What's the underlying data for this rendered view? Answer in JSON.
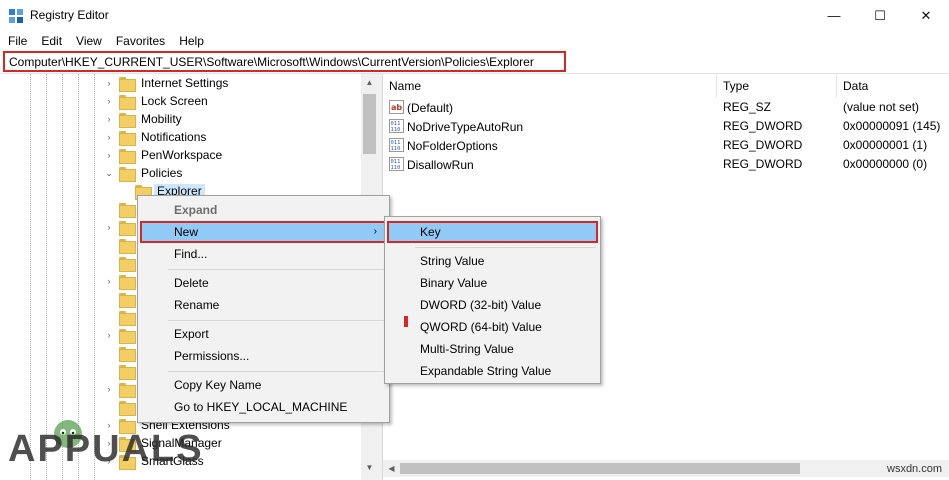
{
  "window": {
    "title": "Registry Editor",
    "minimize_glyph": "—",
    "maximize_glyph": "☐",
    "close_glyph": "✕"
  },
  "menubar": [
    "File",
    "Edit",
    "View",
    "Favorites",
    "Help"
  ],
  "address": "Computer\\HKEY_CURRENT_USER\\Software\\Microsoft\\Windows\\CurrentVersion\\Policies\\Explorer",
  "tree": {
    "items": [
      {
        "label": "Internet Settings",
        "chevron": "›"
      },
      {
        "label": "Lock Screen",
        "chevron": "›"
      },
      {
        "label": "Mobility",
        "chevron": "›"
      },
      {
        "label": "Notifications",
        "chevron": "›"
      },
      {
        "label": "PenWorkspace",
        "chevron": "›"
      },
      {
        "label": "Policies",
        "chevron": "⌄"
      },
      {
        "label": "Explorer",
        "chevron": ""
      },
      {
        "label": "Shell Extensions",
        "chevron": "›"
      },
      {
        "label": "SignalManager",
        "chevron": "›"
      },
      {
        "label": "SmartGlass",
        "chevron": "›"
      }
    ]
  },
  "listview": {
    "columns": [
      "Name",
      "Type",
      "Data"
    ],
    "rows": [
      {
        "icon": "string-value-icon",
        "name": "(Default)",
        "type": "REG_SZ",
        "data": "(value not set)"
      },
      {
        "icon": "binary-value-icon",
        "name": "NoDriveTypeAutoRun",
        "type": "REG_DWORD",
        "data": "0x00000091 (145)"
      },
      {
        "icon": "binary-value-icon",
        "name": "NoFolderOptions",
        "type": "REG_DWORD",
        "data": "0x00000001 (1)"
      },
      {
        "icon": "binary-value-icon",
        "name": "DisallowRun",
        "type": "REG_DWORD",
        "data": "0x00000000 (0)"
      }
    ]
  },
  "context_menu": {
    "expand": "Expand",
    "new": "New",
    "find": "Find...",
    "delete": "Delete",
    "rename": "Rename",
    "export": "Export",
    "permissions": "Permissions...",
    "copy_key_name": "Copy Key Name",
    "goto": "Go to HKEY_LOCAL_MACHINE",
    "submenu_arrow": "›"
  },
  "submenu": {
    "key": "Key",
    "string_value": "String Value",
    "binary_value": "Binary Value",
    "dword_value": "DWORD (32-bit) Value",
    "qword_value": "QWORD (64-bit) Value",
    "multi_string_value": "Multi-String Value",
    "expandable_string_value": "Expandable String Value"
  },
  "scroll_arrows": {
    "up": "▲",
    "down": "▼",
    "left": "◀",
    "right": "▶"
  },
  "watermark": {
    "logo": "APPUALS",
    "site": "wsxdn.com"
  },
  "colors": {
    "highlight": "#91c9f7",
    "annotation_red": "#d62727",
    "tree_selection": "#cce8ff"
  }
}
